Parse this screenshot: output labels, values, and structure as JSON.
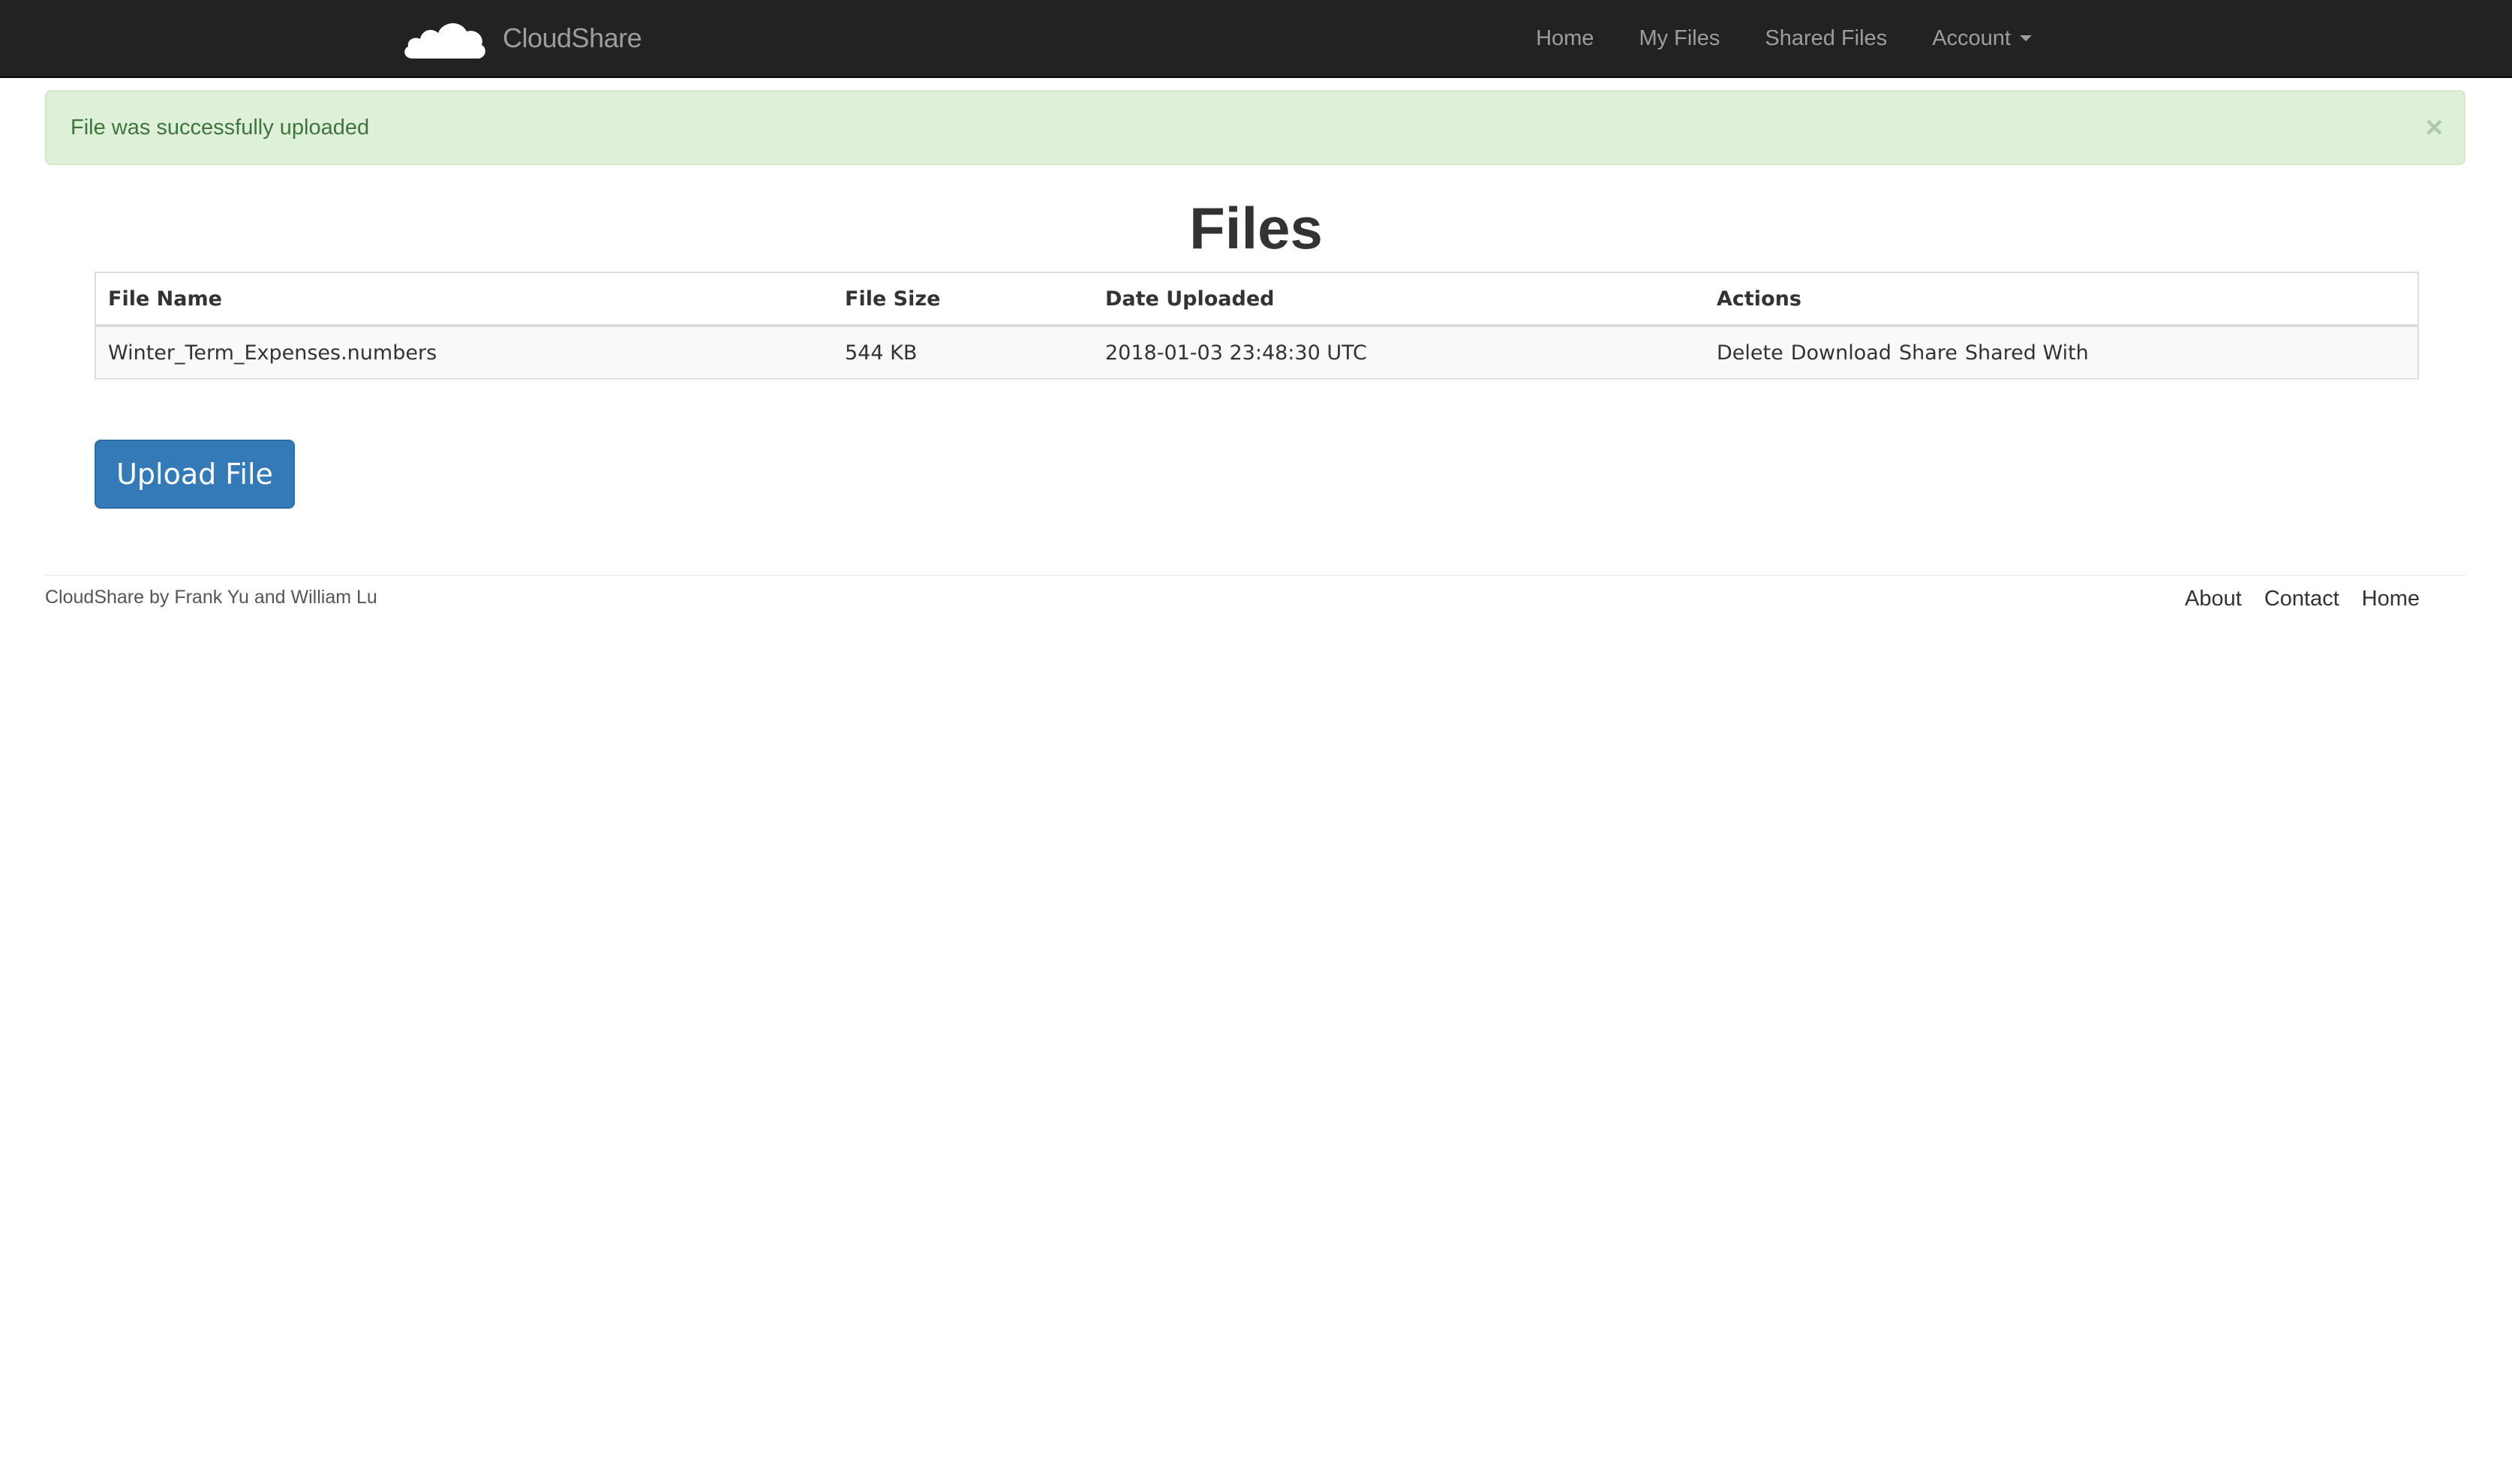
{
  "navbar": {
    "brand": "CloudShare",
    "items": [
      {
        "label": "Home"
      },
      {
        "label": "My Files"
      },
      {
        "label": "Shared Files"
      },
      {
        "label": "Account"
      }
    ]
  },
  "alert": {
    "message": "File was successfully uploaded",
    "close_symbol": "×"
  },
  "main": {
    "title": "Files",
    "table": {
      "headers": [
        "File Name",
        "File Size",
        "Date Uploaded",
        "Actions"
      ],
      "rows": [
        {
          "name": "Winter_Term_Expenses.numbers",
          "size": "544 KB",
          "date": "2018-01-03 23:48:30 UTC",
          "actions": [
            "Delete",
            "Download",
            "Share",
            "Shared With"
          ]
        }
      ]
    },
    "upload_label": "Upload File"
  },
  "footer": {
    "credit": "CloudShare by Frank Yu and William Lu",
    "links": [
      "About",
      "Contact",
      "Home"
    ]
  },
  "colors": {
    "navbar_bg": "#222222",
    "alert_bg": "#dff0d8",
    "alert_text": "#3c763d",
    "primary_button": "#337ab7"
  }
}
